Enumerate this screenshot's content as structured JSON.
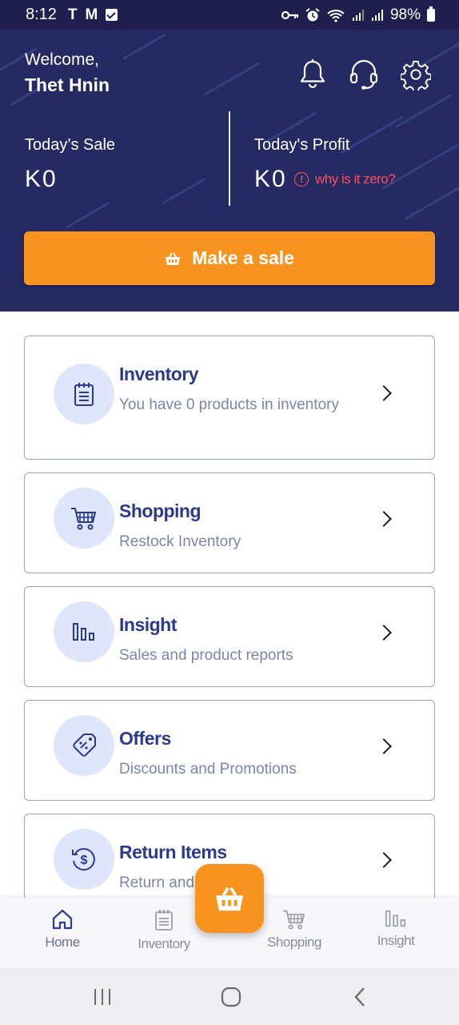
{
  "status_bar": {
    "time": "8:12",
    "notif_t": "T",
    "notif_m": "M",
    "battery": "98%"
  },
  "header": {
    "welcome": "Welcome,",
    "user_name": "Thet Hnin",
    "todays_sale_label": "Today’s Sale",
    "todays_sale_value": "K0",
    "todays_profit_label": "Today's Profit",
    "todays_profit_value": "K0",
    "why_zero_link": "why is it zero?",
    "make_sale_label": "Make a sale"
  },
  "menu": [
    {
      "title": "Inventory",
      "subtitle": "You have 0 products in inventory",
      "icon": "clipboard-icon"
    },
    {
      "title": "Shopping",
      "subtitle": "Restock Inventory",
      "icon": "cart-icon"
    },
    {
      "title": "Insight",
      "subtitle": "Sales and product reports",
      "icon": "bar-chart-icon"
    },
    {
      "title": "Offers",
      "subtitle": "Discounts and Promotions",
      "icon": "tag-icon"
    },
    {
      "title": "Return Items",
      "subtitle": "Return and",
      "icon": "refund-dollar-icon"
    }
  ],
  "bottom_nav": {
    "home": "Home",
    "inventory": "Inventory",
    "shopping": "Shopping",
    "insight": "Insight"
  },
  "colors": {
    "header_bg": "#262a62",
    "accent": "#f7931e",
    "title_blue": "#2b3a8c",
    "warning": "#ff4d5a"
  }
}
